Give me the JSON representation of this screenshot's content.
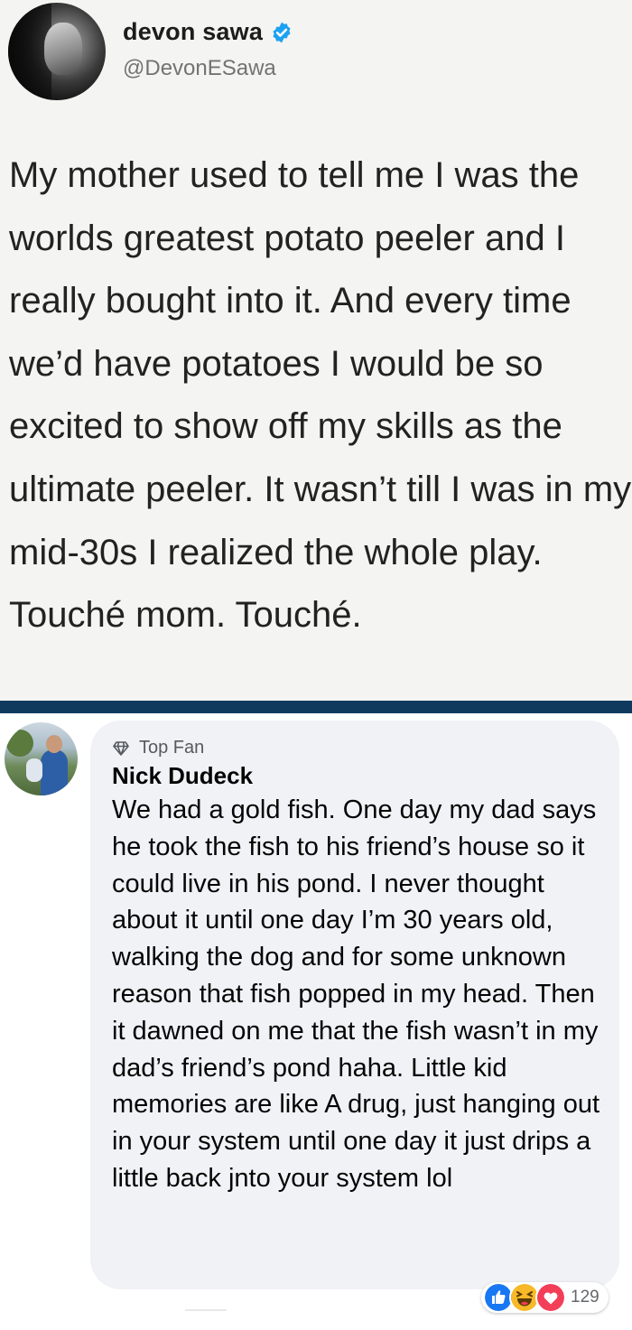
{
  "tweet": {
    "display_name": "devon sawa",
    "handle": "@DevonESawa",
    "verified_icon": "verified-badge-icon",
    "text": "My mother used to tell me I was the worlds greatest potato peeler and I really bought into it. And every time we’d have potatoes I would be so excited to show off my skills as the ultimate peeler. It wasn’t till I was in my mid-30s I realized the whole play. Touché mom. Touché."
  },
  "comment": {
    "badge_icon": "diamond-icon",
    "badge_label": "Top Fan",
    "author": "Nick Dudeck",
    "text": "We had a gold fish. One day my dad says he took the fish to his friend’s house so it could live in his pond. I never thought about it until one day I’m 30 years old, walking the dog and for some unknown reason that fish popped in my head. Then it dawned on me that the fish wasn’t in my dad’s friend’s pond haha. Little kid memories are like A drug, just hanging out in your system until one day it just drips a little back jnto your system lol",
    "reactions": {
      "icons": [
        "like-icon",
        "haha-icon",
        "love-icon"
      ],
      "count": "129"
    }
  },
  "colors": {
    "tweet_background": "#f4f4f2",
    "divider": "#0f3a5e",
    "bubble": "#f0f2f5",
    "verified_blue": "#1da1f2",
    "like_blue": "#1877f2",
    "love_red": "#f33e58",
    "haha_yellow": "#f7b928"
  }
}
